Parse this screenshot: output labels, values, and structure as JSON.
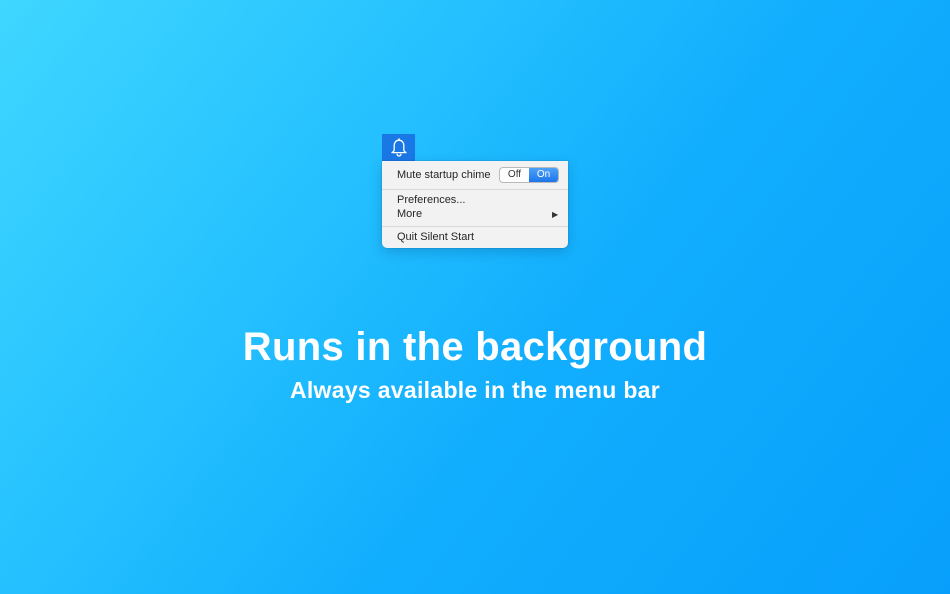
{
  "menubar": {
    "icon": "bell-icon",
    "highlight_color": "#1a78e6"
  },
  "menu": {
    "mute_label": "Mute startup chime",
    "toggle": {
      "off_label": "Off",
      "on_label": "On",
      "selected": "On"
    },
    "preferences_label": "Preferences...",
    "more_label": "More",
    "more_arrow": "▶",
    "quit_label": "Quit Silent Start"
  },
  "hero": {
    "title": "Runs in the background",
    "subtitle": "Always available in the menu bar"
  },
  "colors": {
    "background_start": "#3fd6ff",
    "background_end": "#079ffb",
    "accent": "#1c76ea"
  }
}
